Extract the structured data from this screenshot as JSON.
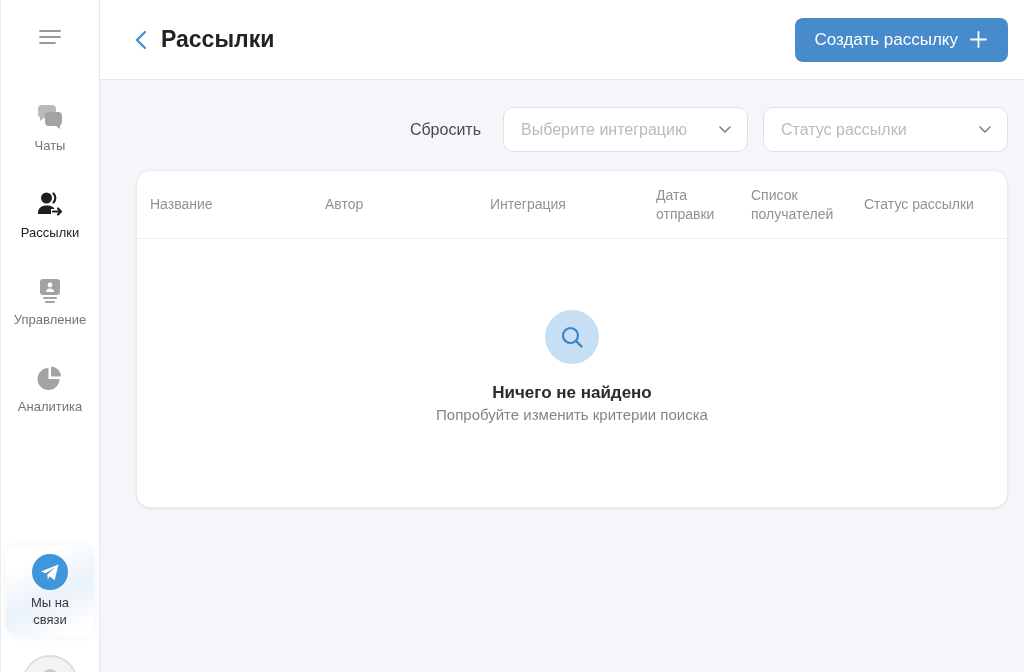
{
  "sidebar": {
    "items": [
      {
        "label": "Чаты",
        "selected": false
      },
      {
        "label": "Рассылки",
        "selected": true
      },
      {
        "label": "Управление",
        "selected": false
      },
      {
        "label": "Аналитика",
        "selected": false
      }
    ],
    "support": {
      "label": "Мы на связи"
    }
  },
  "header": {
    "title": "Рассылки",
    "create_button": "Создать рассылку"
  },
  "filters": {
    "reset": "Сбросить",
    "selects": [
      {
        "placeholder": "Выберите интеграцию"
      },
      {
        "placeholder": "Статус рассылки"
      }
    ]
  },
  "table": {
    "columns": [
      "Название",
      "Автор",
      "Интеграция",
      "Дата отправки",
      "Список получателей",
      "Статус рассылки"
    ],
    "empty": {
      "title": "Ничего не найдено",
      "hint": "Попробуйте изменить критерии поиска"
    }
  }
}
